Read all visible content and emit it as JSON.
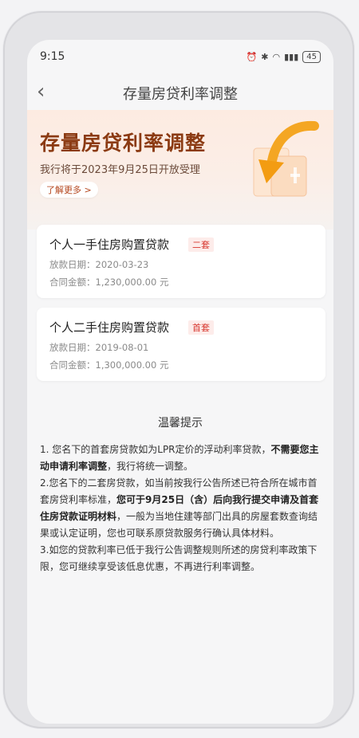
{
  "status_bar": {
    "time": "9:15",
    "battery": "45"
  },
  "nav": {
    "title": "存量房贷利率调整"
  },
  "hero": {
    "title": "存量房贷利率调整",
    "subtitle": "我行将于2023年9月25日开放受理",
    "link": "了解更多 >"
  },
  "loans": [
    {
      "title": "个人一手住房购置贷款",
      "tag": "二套",
      "date_label": "放款日期：",
      "date": "2020-03-23",
      "amount_label": "合同金额：",
      "amount": "1,230,000.00 元"
    },
    {
      "title": "个人二手住房购置贷款",
      "tag": "首套",
      "date_label": "放款日期：",
      "date": "2019-08-01",
      "amount_label": "合同金额：",
      "amount": "1,300,000.00 元"
    }
  ],
  "tips": {
    "title": "温馨提示",
    "p1_a": "1. 您名下的首套房贷款如为LPR定价的浮动利率贷款，",
    "p1_b": "不需要您主动申请利率调整",
    "p1_c": "，我行将统一调整。",
    "p2_a": "2.您名下的二套房贷款，如当前按我行公告所述已符合所在城市首套房贷利率标准，",
    "p2_b": "您可于9月25日（含）后向我行提交申请及首套住房贷款证明材料",
    "p2_c": "，一般为当地住建等部门出具的房屋套数查询结果或认定证明，您也可联系原贷款服务行确认具体材料。",
    "p3": "3.如您的贷款利率已低于我行公告调整规则所述的房贷利率政策下限，您可继续享受该低息优惠，不再进行利率调整。"
  },
  "colors": {
    "accent": "#8b3a12",
    "tag": "#d7372f",
    "hero_bg": "#fdebe1"
  }
}
